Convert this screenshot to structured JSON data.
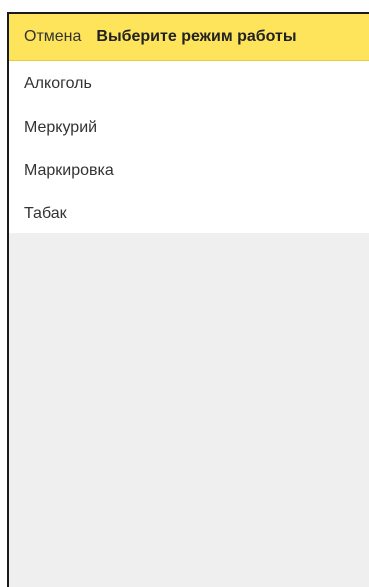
{
  "header": {
    "cancel_label": "Отмена",
    "title": "Выберите режим работы",
    "background_color": "#fde45a"
  },
  "modes": [
    {
      "label": "Алкоголь"
    },
    {
      "label": "Меркурий"
    },
    {
      "label": "Маркировка"
    },
    {
      "label": "Табак"
    }
  ],
  "colors": {
    "list_background": "#ffffff",
    "empty_background": "#efefef"
  }
}
